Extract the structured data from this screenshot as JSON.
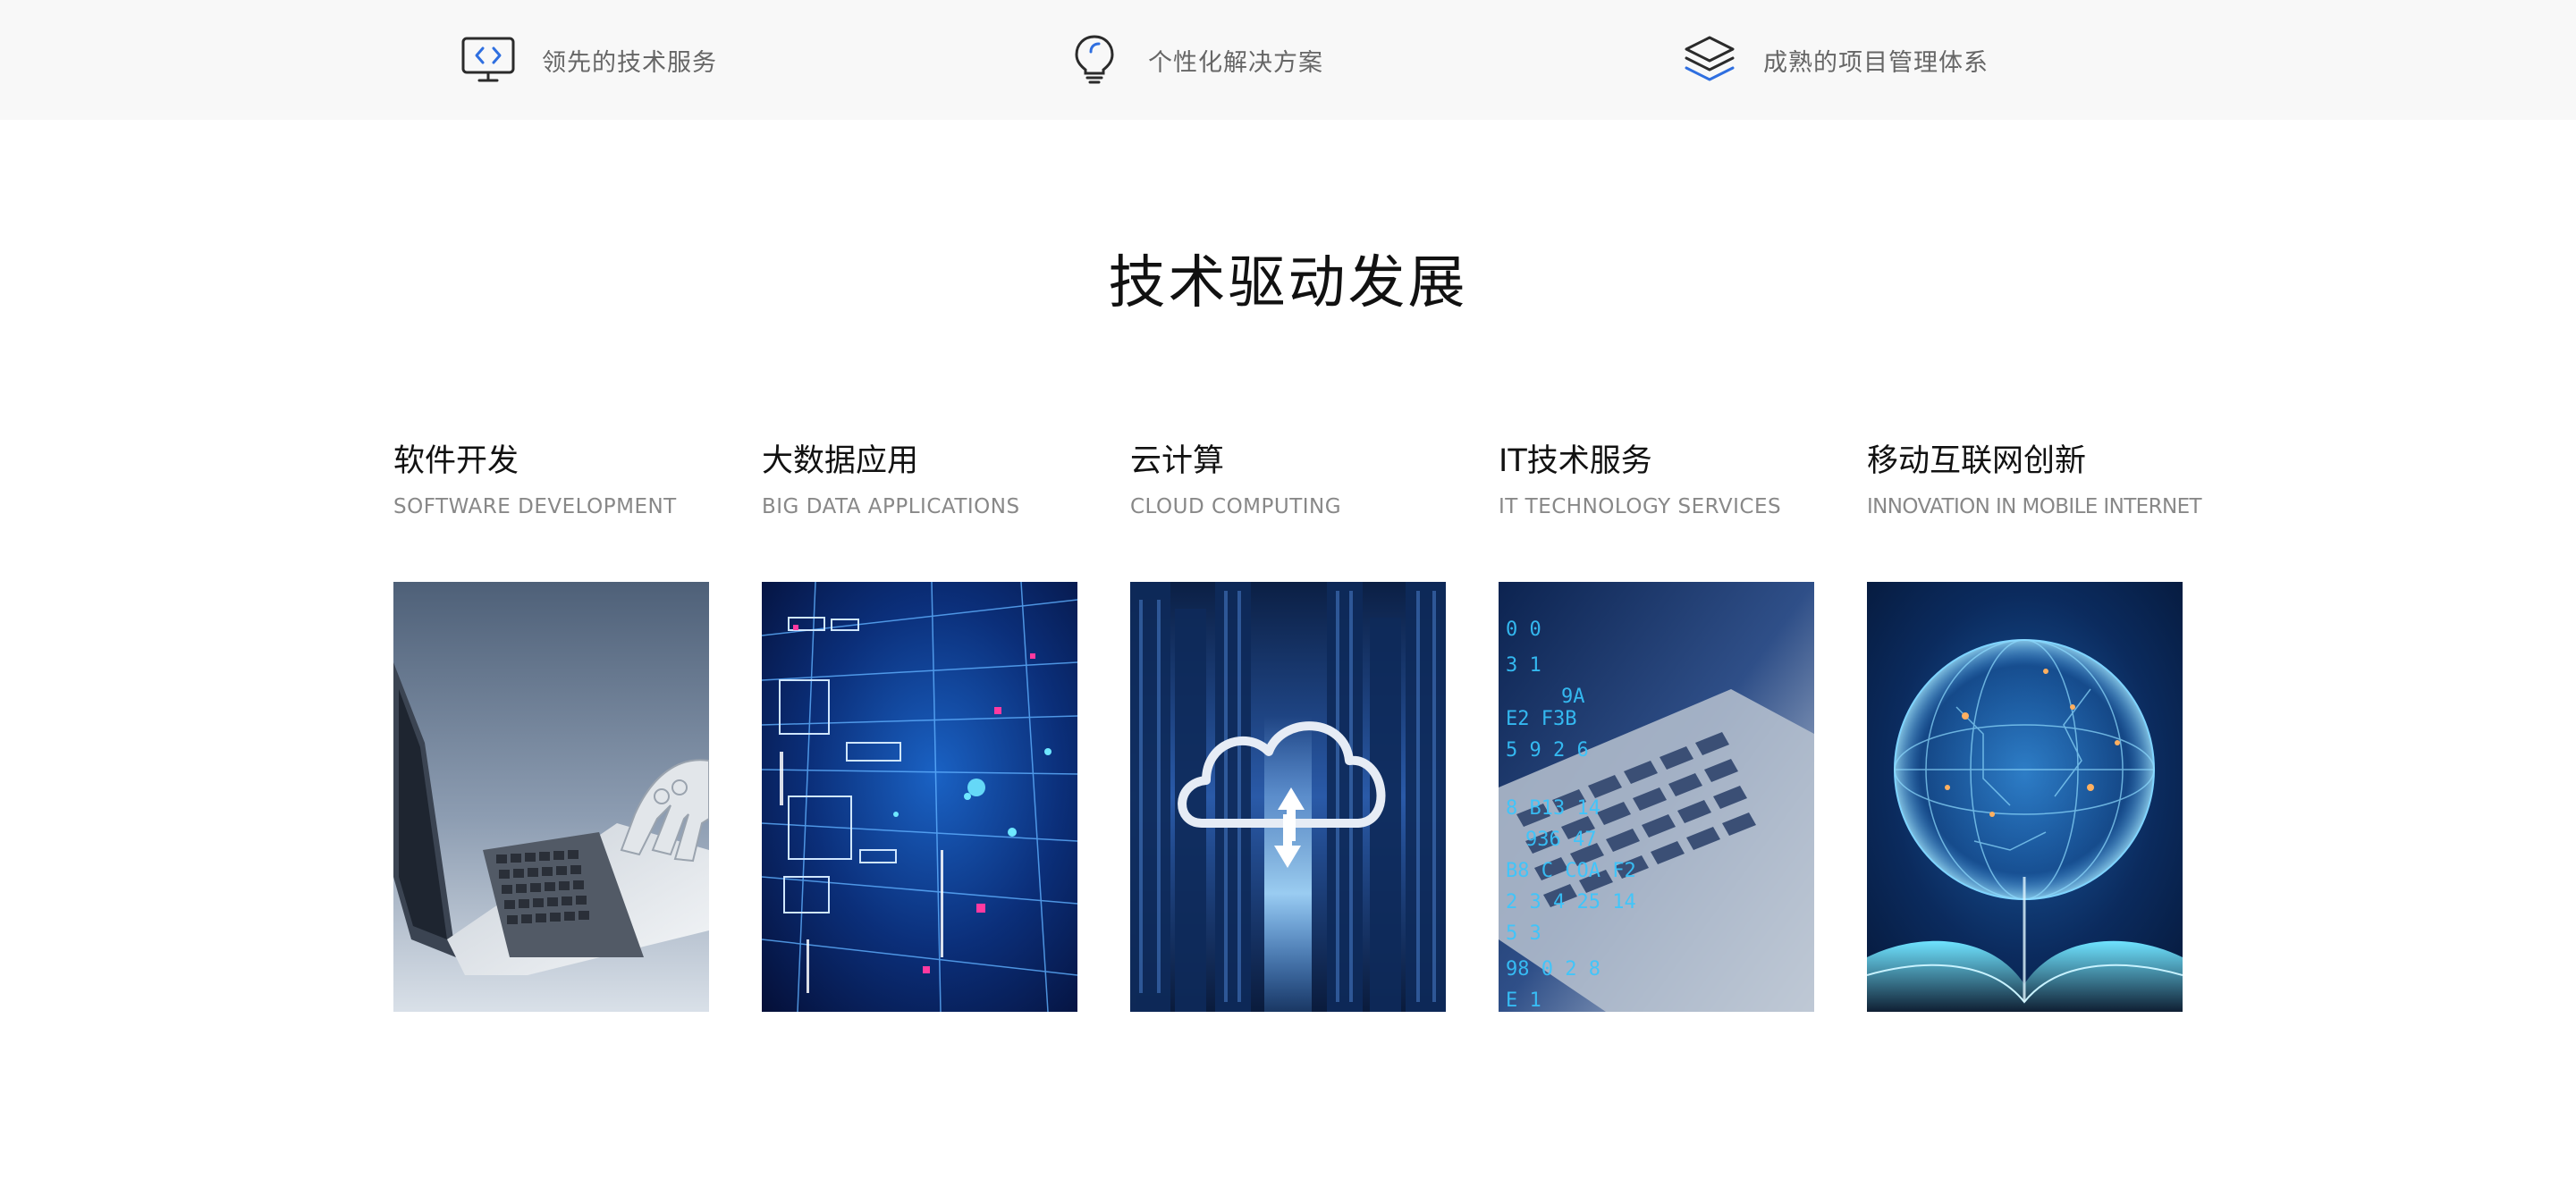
{
  "features": [
    {
      "icon": "code-monitor-icon",
      "label": "领先的技术服务"
    },
    {
      "icon": "lightbulb-icon",
      "label": "个性化解决方案"
    },
    {
      "icon": "layers-icon",
      "label": "成熟的项目管理体系"
    }
  ],
  "section": {
    "title": "技术驱动发展"
  },
  "services": [
    {
      "title": "软件开发",
      "subtitle": "SOFTWARE DEVELOPMENT",
      "image": "robot-typing-laptop-image"
    },
    {
      "title": "大数据应用",
      "subtitle": "BIG DATA APPLICATIONS",
      "image": "data-circuit-image"
    },
    {
      "title": "云计算",
      "subtitle": "CLOUD COMPUTING",
      "image": "cloud-city-image"
    },
    {
      "title": "IT技术服务",
      "subtitle": "IT TECHNOLOGY SERVICES",
      "image": "code-keyboard-image"
    },
    {
      "title": "移动互联网创新",
      "subtitle": "INNOVATION IN MOBILE INTERNET",
      "image": "digital-globe-book-image"
    }
  ],
  "colors": {
    "feature_bar_bg": "#f8f8f8",
    "accent_blue": "#2f6fe0",
    "icon_dark": "#2b2b2b",
    "title_text": "#111111",
    "subtitle_text": "#888888"
  }
}
